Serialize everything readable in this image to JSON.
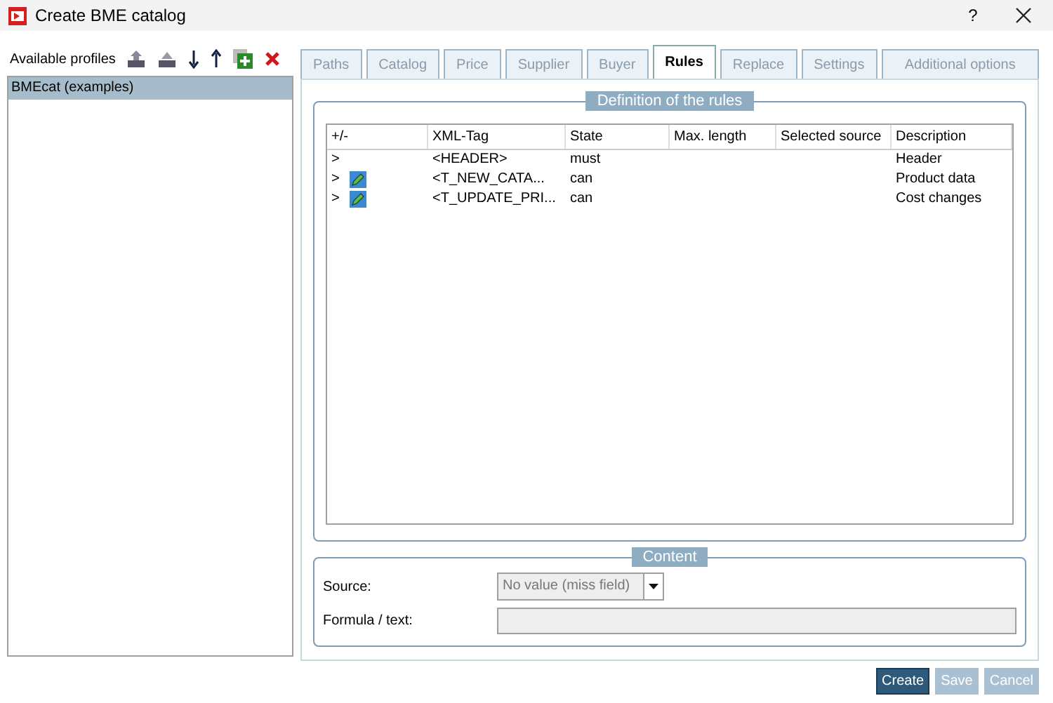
{
  "window": {
    "title": "Create BME catalog",
    "help": "?"
  },
  "profiles": {
    "label": "Available profiles",
    "items": [
      {
        "name": "BMEcat (examples)",
        "selected": true
      }
    ]
  },
  "tabs": [
    {
      "label": "Paths",
      "selected": false
    },
    {
      "label": "Catalog",
      "selected": false
    },
    {
      "label": "Price",
      "selected": false
    },
    {
      "label": "Supplier",
      "selected": false
    },
    {
      "label": "Buyer",
      "selected": false
    },
    {
      "label": "Rules",
      "selected": true
    },
    {
      "label": "Replace",
      "selected": false
    },
    {
      "label": "Settings",
      "selected": false
    },
    {
      "label": "Additional options",
      "selected": false
    }
  ],
  "rules": {
    "title": "Definition of the rules",
    "columns": [
      "+/-",
      "XML-Tag",
      "State",
      "Max. length",
      "Selected source",
      "Description"
    ],
    "rows": [
      {
        "expander": ">",
        "icon": false,
        "tag": "<HEADER>",
        "state": "must",
        "description": "Header"
      },
      {
        "expander": ">",
        "icon": true,
        "tag": "<T_NEW_CATA...",
        "state": "can",
        "description": "Product data"
      },
      {
        "expander": ">",
        "icon": true,
        "tag": "<T_UPDATE_PRI...",
        "state": "can",
        "description": "Cost changes"
      }
    ]
  },
  "content": {
    "title": "Content",
    "source_label": "Source:",
    "source_value": "No value (miss field)",
    "formula_label": "Formula / text:",
    "disabled": true
  },
  "buttons": [
    {
      "label": "Create",
      "disabled": false
    },
    {
      "label": "Save",
      "disabled": true
    },
    {
      "label": "Cancel",
      "disabled": true
    }
  ]
}
